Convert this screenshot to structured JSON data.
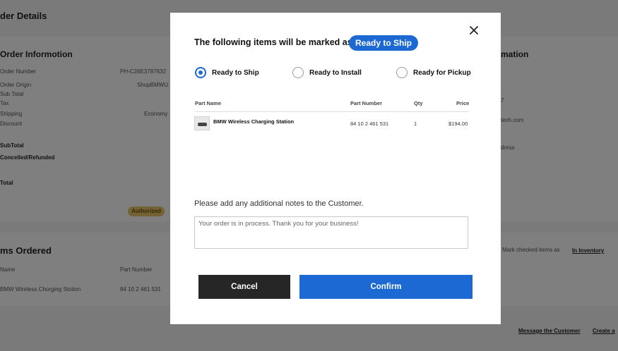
{
  "background": {
    "page_title": "der Details",
    "left_card": {
      "title": "Order Informotion",
      "rows": [
        {
          "label": "Order Number",
          "value": "PH-C26E3787632"
        },
        {
          "label": "Order Origin",
          "value": "ShopBMWU"
        },
        {
          "label": "Sub Total",
          "value": ""
        },
        {
          "label": "Tax",
          "value": ""
        },
        {
          "label": "Shipping",
          "value": "Economy"
        },
        {
          "label": "Discount",
          "value": ""
        }
      ],
      "subtotal_label": "SubTotal",
      "cancelled_label": "Concelled/Refunded",
      "total_label": "Total",
      "authorized_badge": "Authorized"
    },
    "right_card": {
      "title": "mation",
      "lines": [
        "7",
        "tech.com",
        "dress"
      ]
    },
    "items_card": {
      "title": "ms Ordered",
      "col_name": "Name",
      "col_part_number": "Part Number",
      "row_name": "BMW Wireless Chorging Stotion",
      "row_part_number": "84 10 2 461 531",
      "mark_checked": "Mark checked items as",
      "in_inventory": "In Inventory"
    },
    "footer_links": [
      "Message the Customer",
      "Create a"
    ]
  },
  "modal": {
    "heading": "The following items will be marked as",
    "status_pill": "Ready to Ship",
    "options": [
      {
        "label": "Ready to Ship",
        "checked": true
      },
      {
        "label": "Ready to Install",
        "checked": false
      },
      {
        "label": "Ready for Pickup",
        "checked": false
      }
    ],
    "table": {
      "headers": {
        "part_name": "Part Name",
        "part_number": "Part Number",
        "qty": "Qty",
        "price": "Price"
      },
      "rows": [
        {
          "part_name": "BMW Wireless Charging Station",
          "part_number": "84 10 2 461 531",
          "qty": "1",
          "price": "$194.00"
        }
      ]
    },
    "notes_label": "Please add any additional notes to the Customer.",
    "notes_value": "Your order is in process. Thank you for your business!",
    "cancel_label": "Cancel",
    "confirm_label": "Confirm"
  },
  "colors": {
    "accent": "#1c69d3",
    "dark_button": "#262626",
    "badge": "#e9c46a"
  },
  "icons": {
    "close": "close-icon",
    "thumbnail": "product-thumbnail"
  }
}
